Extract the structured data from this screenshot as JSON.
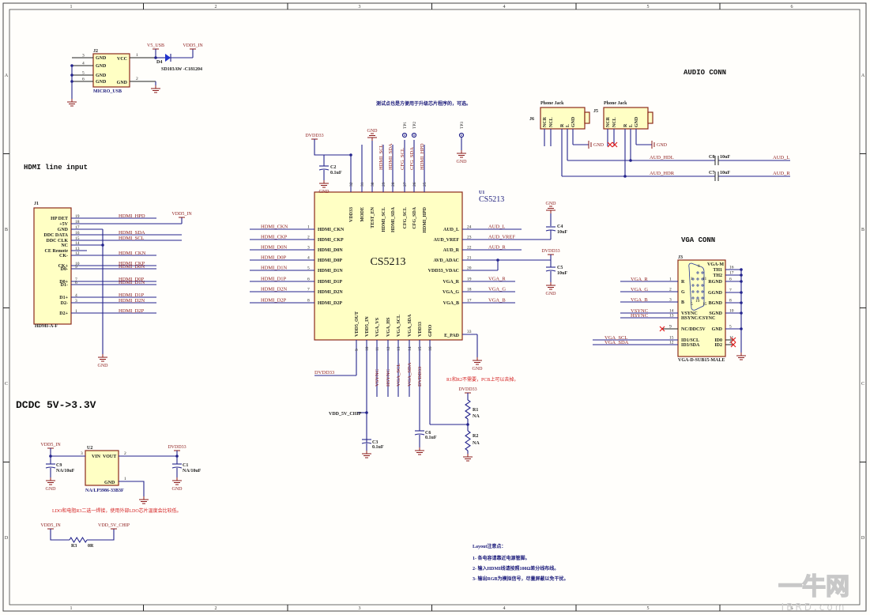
{
  "border": {
    "cols": [
      "1",
      "2",
      "3",
      "4",
      "5",
      "6"
    ],
    "rows": [
      "A",
      "B",
      "C",
      "D"
    ]
  },
  "usb": {
    "ref": "J2",
    "part": "MICRO_USB",
    "diode_ref": "D4",
    "diode_part": "SD103AW -C181204",
    "net_v5": "V5_USB",
    "net_vdd5": "VDD5_IN",
    "pins_left": [
      {
        "n": "3",
        "name": "GND"
      },
      {
        "n": "4",
        "name": "GND"
      },
      {
        "n": "5",
        "name": "GND"
      },
      {
        "n": "6",
        "name": "GND"
      }
    ],
    "pins_right": [
      {
        "n": "1",
        "name": "VCC"
      },
      {
        "n": "2",
        "name": "GND"
      }
    ]
  },
  "hdmi": {
    "title": "HDMI line input",
    "ref": "J1",
    "footprint": "HDMI-A-F",
    "vdd": "VDD5_IN",
    "gnd": "GND",
    "pins": [
      {
        "n": "19",
        "name": "HP DET",
        "net": "HDMI_HPD"
      },
      {
        "n": "18",
        "name": "+5V",
        "net": ""
      },
      {
        "n": "17",
        "name": "GND",
        "net": ""
      },
      {
        "n": "16",
        "name": "DDC DATA",
        "net": "HDMI_SDA"
      },
      {
        "n": "15",
        "name": "DDC CLK",
        "net": "HDMI_SCL"
      },
      {
        "n": "14",
        "name": "NC",
        "net": ""
      },
      {
        "n": "13",
        "name": "CE Remote",
        "net": ""
      },
      {
        "n": "12",
        "name": "CK-",
        "net": "HDMI_CKN"
      },
      {
        "n": "10",
        "name": "CK+",
        "net": "HDMI_CKP"
      },
      {
        "n": "9",
        "name": "D0-",
        "net": "HDMI_D0N"
      },
      {
        "n": "7",
        "name": "D0+",
        "net": "HDMI_D0P"
      },
      {
        "n": "6",
        "name": "D1-",
        "net": "HDMI_D1N"
      },
      {
        "n": "4",
        "name": "D1+",
        "net": "HDMI_D1P"
      },
      {
        "n": "3",
        "name": "D2-",
        "net": "HDMI_D2N"
      },
      {
        "n": "1",
        "name": "D2+",
        "net": "HDMI_D2P"
      }
    ]
  },
  "u1": {
    "ref": "U1",
    "part": "CS5213",
    "center_label": "CS5213",
    "left": [
      {
        "n": "1",
        "name": "HDMI_CKN",
        "net": "HDMI_CKN"
      },
      {
        "n": "2",
        "name": "HDMI_CKP",
        "net": "HDMI_CKP"
      },
      {
        "n": "3",
        "name": "HDMI_D0N",
        "net": "HDMI_D0N"
      },
      {
        "n": "4",
        "name": "HDMI_D0P",
        "net": "HDMI_D0P"
      },
      {
        "n": "5",
        "name": "HDMI_D1N",
        "net": "HDMI_D1N"
      },
      {
        "n": "6",
        "name": "HDMI_D1P",
        "net": "HDMI_D1P"
      },
      {
        "n": "7",
        "name": "HDMI_D2N",
        "net": "HDMI_D2N"
      },
      {
        "n": "8",
        "name": "HDMI_D2P",
        "net": "HDMI_D2P"
      }
    ],
    "right": [
      {
        "n": "24",
        "name": "AUD_L",
        "net": "AUD_L"
      },
      {
        "n": "23",
        "name": "AUD_VREF",
        "net": "AUD_VREF"
      },
      {
        "n": "22",
        "name": "AUD_R",
        "net": "AUD_R"
      },
      {
        "n": "21",
        "name": "AVD_ADAC",
        "net": ""
      },
      {
        "n": "20",
        "name": "VDD33_VDAC",
        "net": ""
      },
      {
        "n": "19",
        "name": "VGA_R",
        "net": "VGA_R"
      },
      {
        "n": "18",
        "name": "VGA_G",
        "net": "VGA_G"
      },
      {
        "n": "17",
        "name": "VGA_B",
        "net": "VGA_B"
      }
    ],
    "epad": {
      "n": "33",
      "name": "E_PAD"
    },
    "top": [
      {
        "n": "32",
        "name": "VDD33",
        "net": ""
      },
      {
        "n": "31",
        "name": "MODE",
        "net": ""
      },
      {
        "n": "30",
        "name": "TEST_EN",
        "net": ""
      },
      {
        "n": "29",
        "name": "HDMI_SCL",
        "net": "HDMI_SCL"
      },
      {
        "n": "28",
        "name": "HDMI_SDA",
        "net": "HDMI_SDA"
      },
      {
        "n": "27",
        "name": "CFG_SCL",
        "net": "CFG_SCL"
      },
      {
        "n": "26",
        "name": "CFG_SDA",
        "net": "CFG_SDA"
      },
      {
        "n": "25",
        "name": "HDMI_HPD",
        "net": "HDMI_HPD"
      }
    ],
    "bottom": [
      {
        "n": "9",
        "name": "VDD5_OUT",
        "net": ""
      },
      {
        "n": "10",
        "name": "VDD5_IN",
        "net": ""
      },
      {
        "n": "11",
        "name": "VGA_VS",
        "net": "VSYNC"
      },
      {
        "n": "12",
        "name": "VGA_HS",
        "net": "HSYNC"
      },
      {
        "n": "13",
        "name": "VGA_SCL",
        "net": "VGA_SCL"
      },
      {
        "n": "14",
        "name": "VGA_SDA",
        "net": "VGA_SDA"
      },
      {
        "n": "15",
        "name": "VDD33",
        "net": "DVDD33"
      },
      {
        "n": "16",
        "name": "GPIO",
        "net": ""
      }
    ],
    "tp": [
      "TP1",
      "TP2",
      "TP3"
    ],
    "tp_note": "测试点也是方便用于升级芯片程序的，可选。",
    "dvdd33": "DVDD33",
    "gnd": "GND",
    "vdd5v_chip": "VDD_5V_CHIP",
    "caps": {
      "c2": {
        "ref": "C2",
        "val": "0.1uF"
      },
      "c4": {
        "ref": "C4",
        "val": "10uF"
      },
      "c5": {
        "ref": "C5",
        "val": "10uF"
      },
      "c3": {
        "ref": "C3",
        "val": "0.1uF"
      },
      "c6": {
        "ref": "C6",
        "val": "0.1uF"
      }
    },
    "r1": {
      "ref": "R1",
      "val": "NA"
    },
    "r2": {
      "ref": "R2",
      "val": "NA"
    },
    "r_note": "R1和R2不需要，PCB上可以去掉。"
  },
  "audio": {
    "title": "AUDIO CONN",
    "j6": {
      "ref": "J6",
      "part": "Phone Jack"
    },
    "j5": {
      "ref": "J5",
      "part": "Phone Jack"
    },
    "jack_pins": [
      "NCR",
      "NCL",
      "R",
      "L",
      "GND"
    ],
    "gnd": "GND",
    "net_hdl": "AUD_HDL",
    "net_hdr": "AUD_HDR",
    "net_l": "AUD_L",
    "net_r": "AUD_R",
    "c8": {
      "ref": "C8",
      "val": "10uF"
    },
    "c7": {
      "ref": "C7",
      "val": "10uF"
    }
  },
  "vga": {
    "title": "VGA CONN",
    "ref": "J3",
    "sub": "VGA-M",
    "part": "VGA-D-SUB15-MALE",
    "left": [
      {
        "n": "1",
        "name": "R",
        "net": "VGA_R"
      },
      {
        "n": "2",
        "name": "G",
        "net": "VGA_G"
      },
      {
        "n": "3",
        "name": "B",
        "net": "VGA_B"
      },
      {
        "n": "14",
        "name": "VSYNC",
        "net": "VSYNC"
      },
      {
        "n": "13",
        "name": "HSYNC/CSYNC",
        "net": "HSYNC"
      },
      {
        "n": "9",
        "name": "NC/DDC5V",
        "net": ""
      },
      {
        "n": "15",
        "name": "ID1/SCL",
        "net": "VGA_SCL"
      },
      {
        "n": "12",
        "name": "ID3/SDA",
        "net": "VGA_SDA"
      }
    ],
    "right": [
      {
        "n": "16",
        "name": "TH1"
      },
      {
        "n": "17",
        "name": "TH2"
      },
      {
        "n": "6",
        "name": "RGND"
      },
      {
        "n": "7",
        "name": "GGND"
      },
      {
        "n": "8",
        "name": "BGND"
      },
      {
        "n": "10",
        "name": "SGND"
      },
      {
        "n": "5",
        "name": "GND"
      },
      {
        "n": "11",
        "name": "ID0"
      },
      {
        "n": "4",
        "name": "ID2"
      }
    ],
    "conn_pins": [
      "6",
      "1",
      "11",
      "10",
      "5",
      "15"
    ]
  },
  "dcdc": {
    "title": "DCDC 5V->3.3V",
    "u2": {
      "ref": "U2",
      "part": "NA/LP3986-33B3F",
      "vin": "VIN",
      "vout": "VOUT",
      "gnd": "GND",
      "pin_vin": "3",
      "pin_vout": "2",
      "pin_gnd": "1"
    },
    "vdd5": "VDD5_IN",
    "dvdd33": "DVDD33",
    "gnd": "GND",
    "c9": {
      "ref": "C9",
      "val": "NA/10uF"
    },
    "c1": {
      "ref": "C1",
      "val": "NA/10uF"
    },
    "note": "LDO和电阻R3二选一焊接，使用外部LDO芯片温度会比较低。",
    "r3": {
      "ref": "R3",
      "val": "0R"
    },
    "vdd5v_chip": "VDD_5V_CHIP"
  },
  "layout_notes": {
    "title": "Layout注意点：",
    "items": [
      "1- 各电容请靠近电源管脚。",
      "2- 输入HDMI线请按照100Ω差分线布线。",
      "3- 输出RGB为模拟信号，尽量屏蔽以免干扰。"
    ]
  },
  "watermark": {
    "cn": "一牛网",
    "en": "IBRD.com"
  }
}
